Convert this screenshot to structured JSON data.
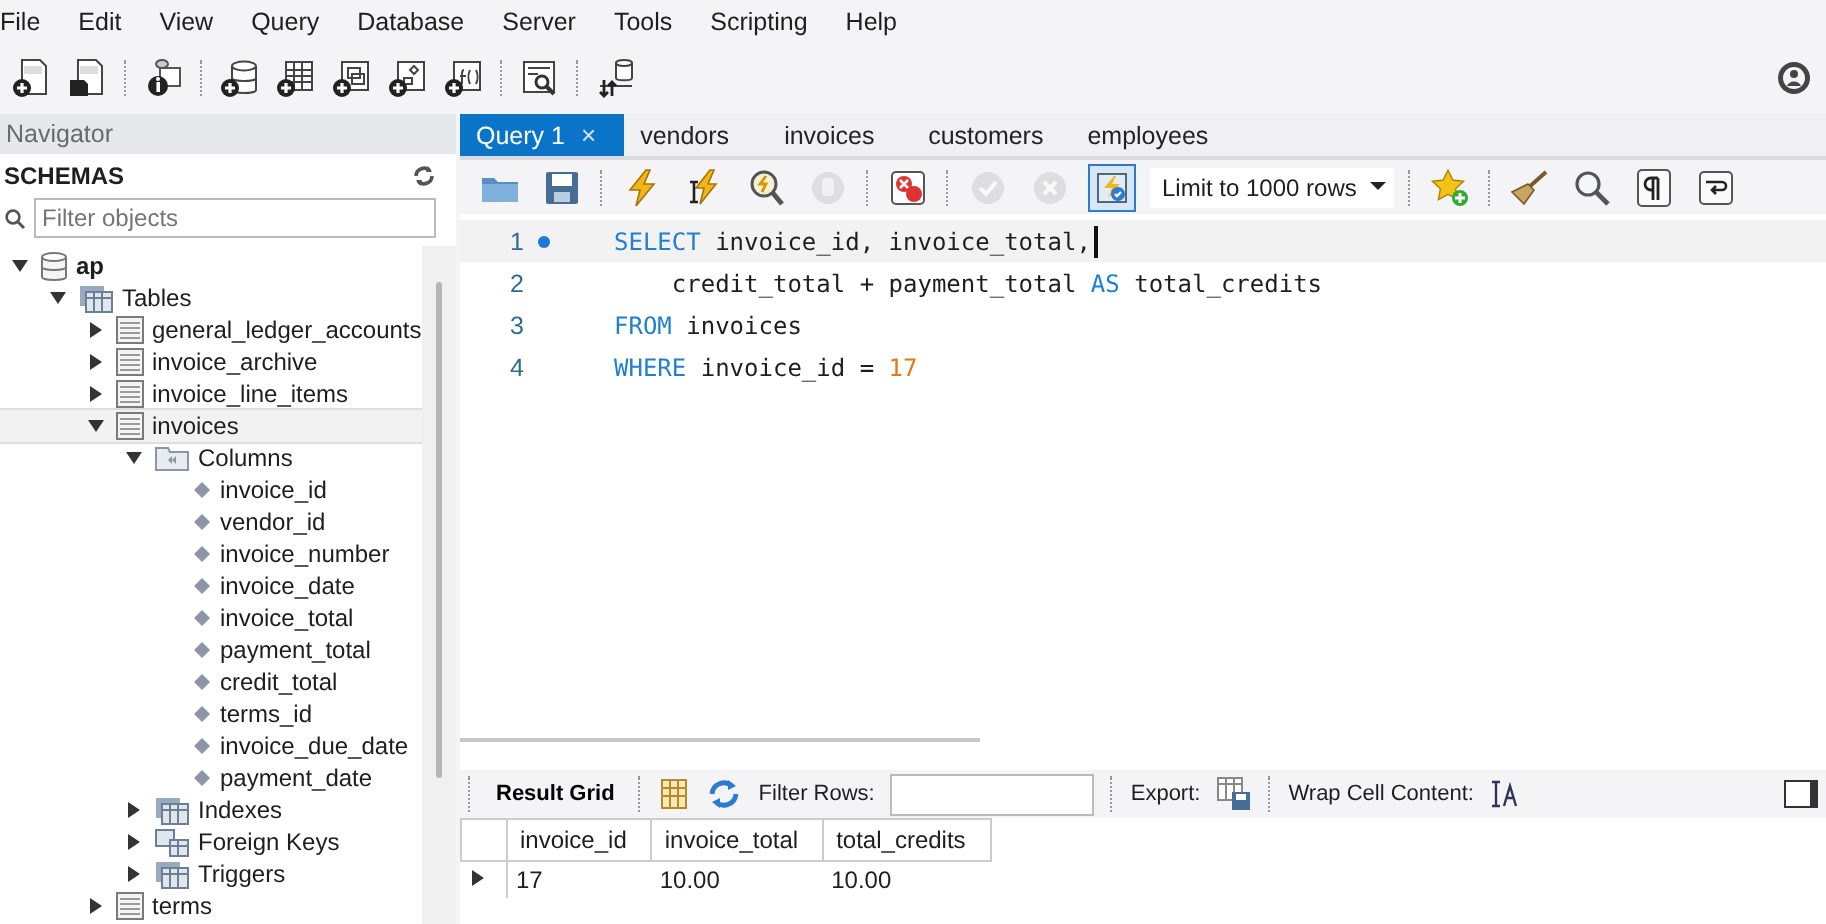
{
  "menu": [
    "File",
    "Edit",
    "View",
    "Query",
    "Database",
    "Server",
    "Tools",
    "Scripting",
    "Help"
  ],
  "navigator": {
    "title": "Navigator",
    "heading": "SCHEMAS",
    "filter": {
      "placeholder": "Filter objects"
    },
    "tree": [
      {
        "label": "ap",
        "kind": "schema",
        "expanded": true,
        "selected": false,
        "children": [
          {
            "label": "Tables",
            "kind": "tables",
            "expanded": true,
            "selected": false,
            "children": [
              {
                "label": "general_ledger_accounts",
                "kind": "table",
                "expanded": false,
                "selected": false
              },
              {
                "label": "invoice_archive",
                "kind": "table",
                "expanded": false,
                "selected": false
              },
              {
                "label": "invoice_line_items",
                "kind": "table",
                "expanded": false,
                "selected": false
              },
              {
                "label": "invoices",
                "kind": "table",
                "expanded": true,
                "selected": true,
                "children": [
                  {
                    "label": "Columns",
                    "kind": "columns",
                    "expanded": true,
                    "selected": false,
                    "children": [
                      {
                        "label": "invoice_id",
                        "kind": "column",
                        "selected": false
                      },
                      {
                        "label": "vendor_id",
                        "kind": "column",
                        "selected": false
                      },
                      {
                        "label": "invoice_number",
                        "kind": "column",
                        "selected": false
                      },
                      {
                        "label": "invoice_date",
                        "kind": "column",
                        "selected": false
                      },
                      {
                        "label": "invoice_total",
                        "kind": "column",
                        "selected": false
                      },
                      {
                        "label": "payment_total",
                        "kind": "column",
                        "selected": false
                      },
                      {
                        "label": "credit_total",
                        "kind": "column",
                        "selected": false
                      },
                      {
                        "label": "terms_id",
                        "kind": "column",
                        "selected": false
                      },
                      {
                        "label": "invoice_due_date",
                        "kind": "column",
                        "selected": false
                      },
                      {
                        "label": "payment_date",
                        "kind": "column",
                        "selected": false
                      }
                    ]
                  },
                  {
                    "label": "Indexes",
                    "kind": "indexes",
                    "expanded": false,
                    "selected": false
                  },
                  {
                    "label": "Foreign Keys",
                    "kind": "foreign-keys",
                    "expanded": false,
                    "selected": false
                  },
                  {
                    "label": "Triggers",
                    "kind": "triggers",
                    "expanded": false,
                    "selected": false
                  }
                ]
              },
              {
                "label": "terms",
                "kind": "table",
                "expanded": false,
                "selected": false
              }
            ]
          }
        ]
      }
    ]
  },
  "tabs": [
    {
      "label": "Query 1",
      "selected": true,
      "close": "×"
    },
    {
      "label": "vendors",
      "selected": false
    },
    {
      "label": "invoices",
      "selected": false
    },
    {
      "label": "customers",
      "selected": false
    },
    {
      "label": "employees",
      "selected": false
    }
  ],
  "query_toolbar": {
    "tools": [
      {
        "kind": "open",
        "disabled": false,
        "on": false
      },
      {
        "kind": "save",
        "disabled": false,
        "on": false
      },
      {
        "kind": "sep"
      },
      {
        "kind": "execute",
        "disabled": false,
        "on": false
      },
      {
        "kind": "execute-current",
        "disabled": false,
        "on": false
      },
      {
        "kind": "explain",
        "disabled": false,
        "on": false
      },
      {
        "kind": "stop",
        "disabled": true,
        "on": false
      },
      {
        "kind": "sep"
      },
      {
        "kind": "stop-on-error",
        "disabled": false,
        "on": false
      },
      {
        "kind": "sep"
      },
      {
        "kind": "commit",
        "disabled": true,
        "on": false
      },
      {
        "kind": "rollback",
        "disabled": true,
        "on": false
      },
      {
        "kind": "autocommit",
        "disabled": false,
        "on": true
      }
    ],
    "limit": "Limit to 1000 rows",
    "tools_after": [
      {
        "kind": "sep"
      },
      {
        "kind": "snippet",
        "disabled": false,
        "on": false
      },
      {
        "kind": "sep"
      },
      {
        "kind": "beautify",
        "disabled": false,
        "on": false
      },
      {
        "kind": "find",
        "disabled": false,
        "on": false
      },
      {
        "kind": "invisibles",
        "disabled": false,
        "on": false
      },
      {
        "kind": "wrap",
        "disabled": false,
        "on": false
      }
    ]
  },
  "editor": {
    "lines": [
      {
        "number": "1",
        "current": true,
        "marker": true,
        "segments": [
          {
            "text": "SELECT",
            "kind": "keyword"
          },
          {
            "text": " invoice_id, invoice_total,",
            "kind": "plain"
          }
        ]
      },
      {
        "number": "2",
        "current": false,
        "marker": false,
        "segments": [
          {
            "text": "    credit_total + payment_total ",
            "kind": "plain"
          },
          {
            "text": "AS",
            "kind": "keyword"
          },
          {
            "text": " total_credits",
            "kind": "plain"
          }
        ]
      },
      {
        "number": "3",
        "current": false,
        "marker": false,
        "segments": [
          {
            "text": "FROM",
            "kind": "keyword"
          },
          {
            "text": " invoices",
            "kind": "plain"
          }
        ]
      },
      {
        "number": "4",
        "current": false,
        "marker": false,
        "segments": [
          {
            "text": "WHERE",
            "kind": "keyword"
          },
          {
            "text": " invoice_id = ",
            "kind": "plain"
          },
          {
            "text": "17",
            "kind": "number"
          }
        ]
      }
    ]
  },
  "result_toolbar": {
    "tab": "Result Grid",
    "filter_label": "Filter Rows:",
    "export_label": "Export:",
    "wrap_label": "Wrap Cell Content:"
  },
  "result": {
    "columns": [
      "invoice_id",
      "invoice_total",
      "total_credits"
    ],
    "rows": [
      {
        "current": true,
        "cells": [
          "17",
          "10.00",
          "10.00"
        ]
      }
    ]
  }
}
